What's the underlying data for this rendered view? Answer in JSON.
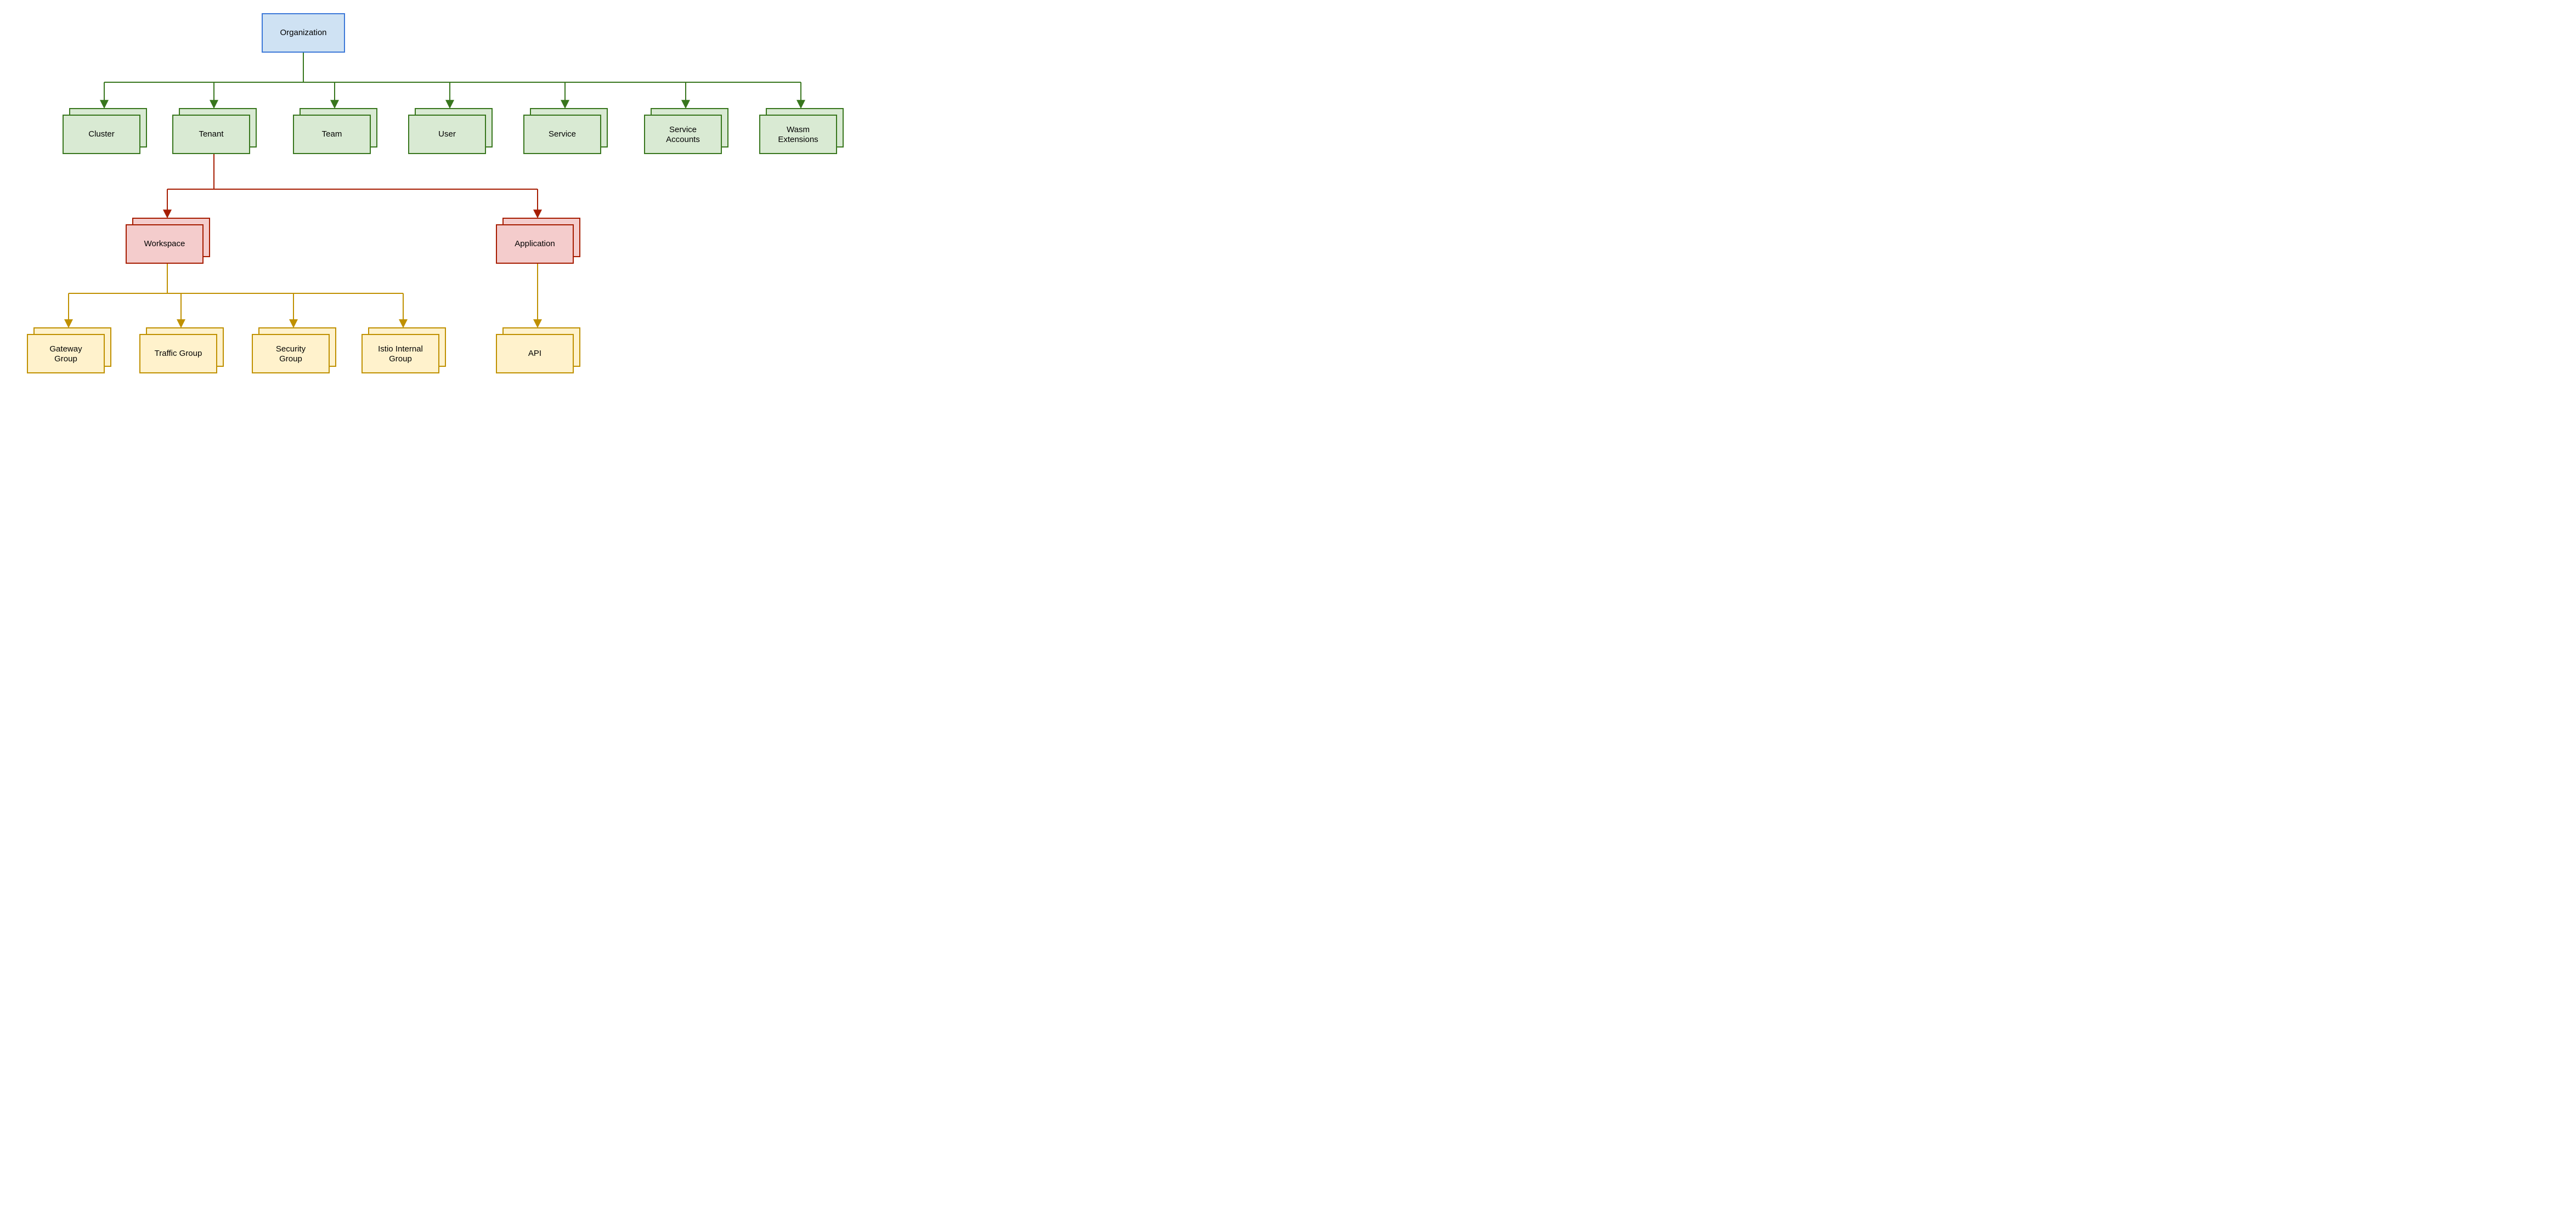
{
  "colors": {
    "blue_fill": "#CFE2F3",
    "blue_stroke": "#3C78D8",
    "green_fill": "#D9EAD3",
    "green_stroke": "#38761D",
    "red_fill": "#F4CCCC",
    "red_stroke": "#A61C00",
    "yellow_fill": "#FFF2CC",
    "yellow_stroke": "#BF9000"
  },
  "nodes": {
    "organization": "Organization",
    "cluster": "Cluster",
    "tenant": "Tenant",
    "team": "Team",
    "user": "User",
    "service": "Service",
    "service_accounts_l1": "Service",
    "service_accounts_l2": "Accounts",
    "wasm_l1": "Wasm",
    "wasm_l2": "Extensions",
    "workspace": "Workspace",
    "application": "Application",
    "gateway_l1": "Gateway",
    "gateway_l2": "Group",
    "traffic_group": "Traffic Group",
    "security_l1": "Security",
    "security_l2": "Group",
    "istio_l1": "Istio Internal",
    "istio_l2": "Group",
    "api": "API"
  }
}
